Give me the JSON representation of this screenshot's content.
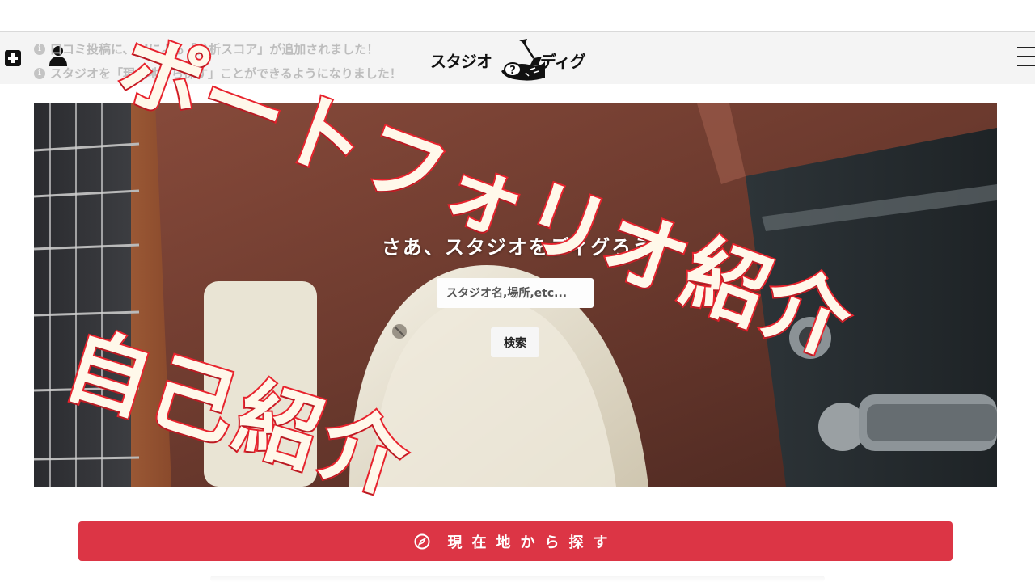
{
  "header": {
    "notices": [
      "口コミ投稿に、AIによる「分析スコア」が追加されました！",
      "スタジオを「現在地から探す」ことができるようになりました！"
    ],
    "logo_left": "スタジオ",
    "logo_mark": "?",
    "logo_right": "ディグ"
  },
  "hero": {
    "heading": "さあ、スタジオをディグろう",
    "search_placeholder": "スタジオ名,場所,etc...",
    "search_button": "検索"
  },
  "overlay": {
    "portfolio": "ポートフォリオ紹介",
    "self_intro": "自己紹介"
  },
  "locate_button": "現在地から探す",
  "colors": {
    "accent_red": "#dc3545",
    "overlay_stroke": "#e8232d",
    "overlay_fill": "#fff8ea"
  },
  "icons": {
    "add": "plus-square-icon",
    "user": "user-icon",
    "menu": "hamburger-menu-icon",
    "info": "info-circle-icon",
    "compass": "compass-icon"
  }
}
